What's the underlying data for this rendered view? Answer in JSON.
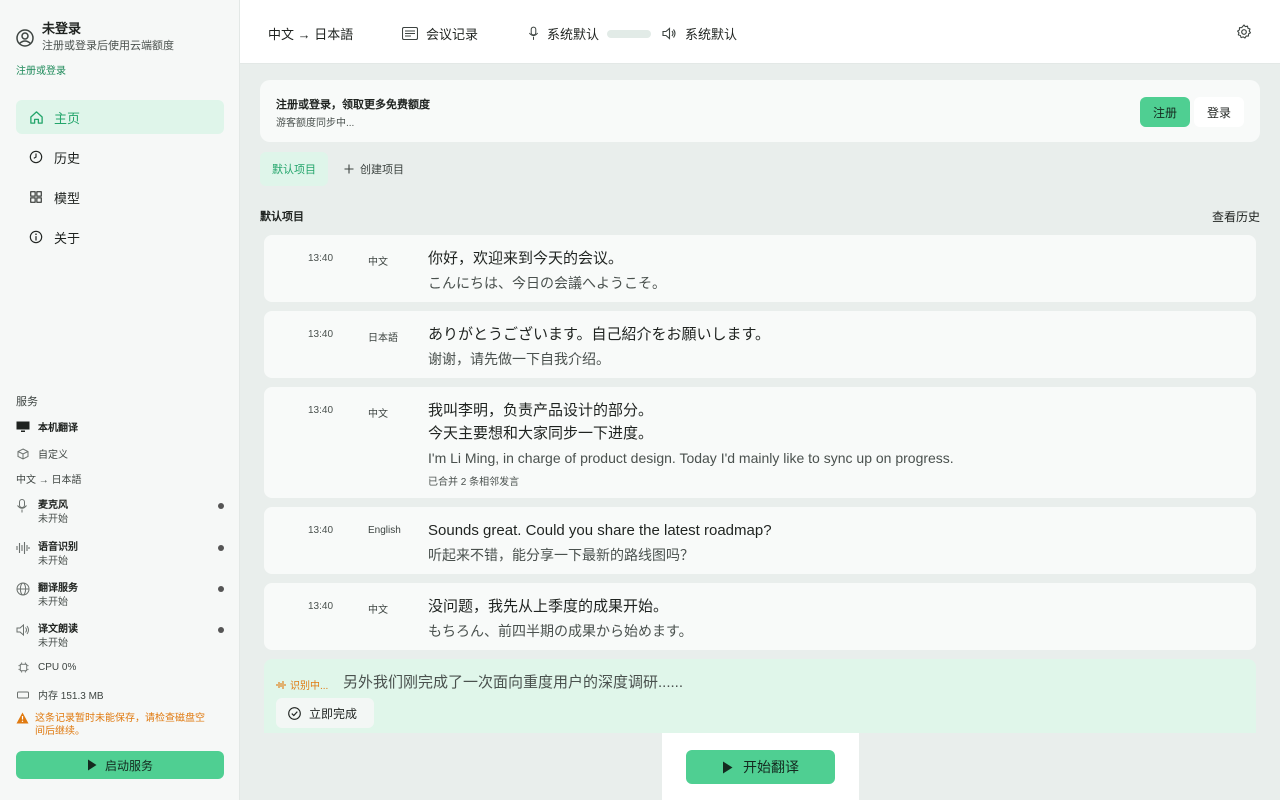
{
  "user": {
    "name": "未登录",
    "subtitle": "注册或登录后使用云端额度",
    "login_link": "注册或登录"
  },
  "nav": [
    {
      "label": "主页",
      "icon": "home-icon",
      "active": true
    },
    {
      "label": "历史",
      "icon": "clock-icon"
    },
    {
      "label": "模型",
      "icon": "grid-icon"
    },
    {
      "label": "关于",
      "icon": "info-icon"
    }
  ],
  "services": {
    "title": "服务",
    "local": "本机翻译",
    "custom": "自定义",
    "lang_pair": "中文 → 日本語",
    "items": [
      {
        "title": "麦克风",
        "status": "未开始",
        "icon": "microphone-icon"
      },
      {
        "title": "语音识别",
        "status": "未开始",
        "icon": "waveform-icon"
      },
      {
        "title": "翻译服务",
        "status": "未开始",
        "icon": "globe-icon"
      },
      {
        "title": "译文朗读",
        "status": "未开始",
        "icon": "speaker-icon"
      }
    ],
    "cpu": "CPU 0%",
    "memory": "内存 151.3 MB",
    "warning": "这条记录暂时未能保存，请检查磁盘空间后继续。",
    "start_button": "启动服务"
  },
  "topbar": {
    "lang": "中文 → 日本語",
    "meeting": "会议记录",
    "mic": "系统默认",
    "speaker": "系统默认"
  },
  "banner": {
    "title": "注册或登录，领取更多免费额度",
    "subtitle": "游客额度同步中...",
    "register": "注册",
    "login": "登录"
  },
  "projects": {
    "active": "默认项目",
    "create": "创建项目"
  },
  "section": {
    "label": "默认项目",
    "history": "查看历史"
  },
  "entries": [
    {
      "time": "13:40",
      "lang": "中文",
      "src": "你好，欢迎来到今天的会议。",
      "tr": "こんにちは、今日の会議へようこそ。"
    },
    {
      "time": "13:40",
      "lang": "日本語",
      "src": "ありがとうございます。自己紹介をお願いします。",
      "tr": "谢谢，请先做一下自我介绍。"
    },
    {
      "time": "13:40",
      "lang": "中文",
      "src1": "我叫李明，负责产品设计的部分。",
      "src2": "今天主要想和大家同步一下进度。",
      "tr": "I'm Li Ming, in charge of product design. Today I'd mainly like to sync up on progress.",
      "merged": "已合并 2 条相邻发言"
    },
    {
      "time": "13:40",
      "lang": "English",
      "src": "Sounds great. Could you share the latest roadmap?",
      "tr": "听起来不错，能分享一下最新的路线图吗？"
    },
    {
      "time": "13:40",
      "lang": "中文",
      "src": "没问题，我先从上季度的成果开始。",
      "tr": "もちろん、前四半期の成果から始めます。"
    }
  ],
  "live": {
    "badge": "识别中...",
    "text": "另外我们刚完成了一次面向重度用户的深度调研......",
    "done": "立即完成"
  },
  "start_translate": "开始翻译",
  "colors": {
    "accent": "#4fcf92",
    "accent_text": "#23a56b",
    "warning": "#e07a10"
  }
}
